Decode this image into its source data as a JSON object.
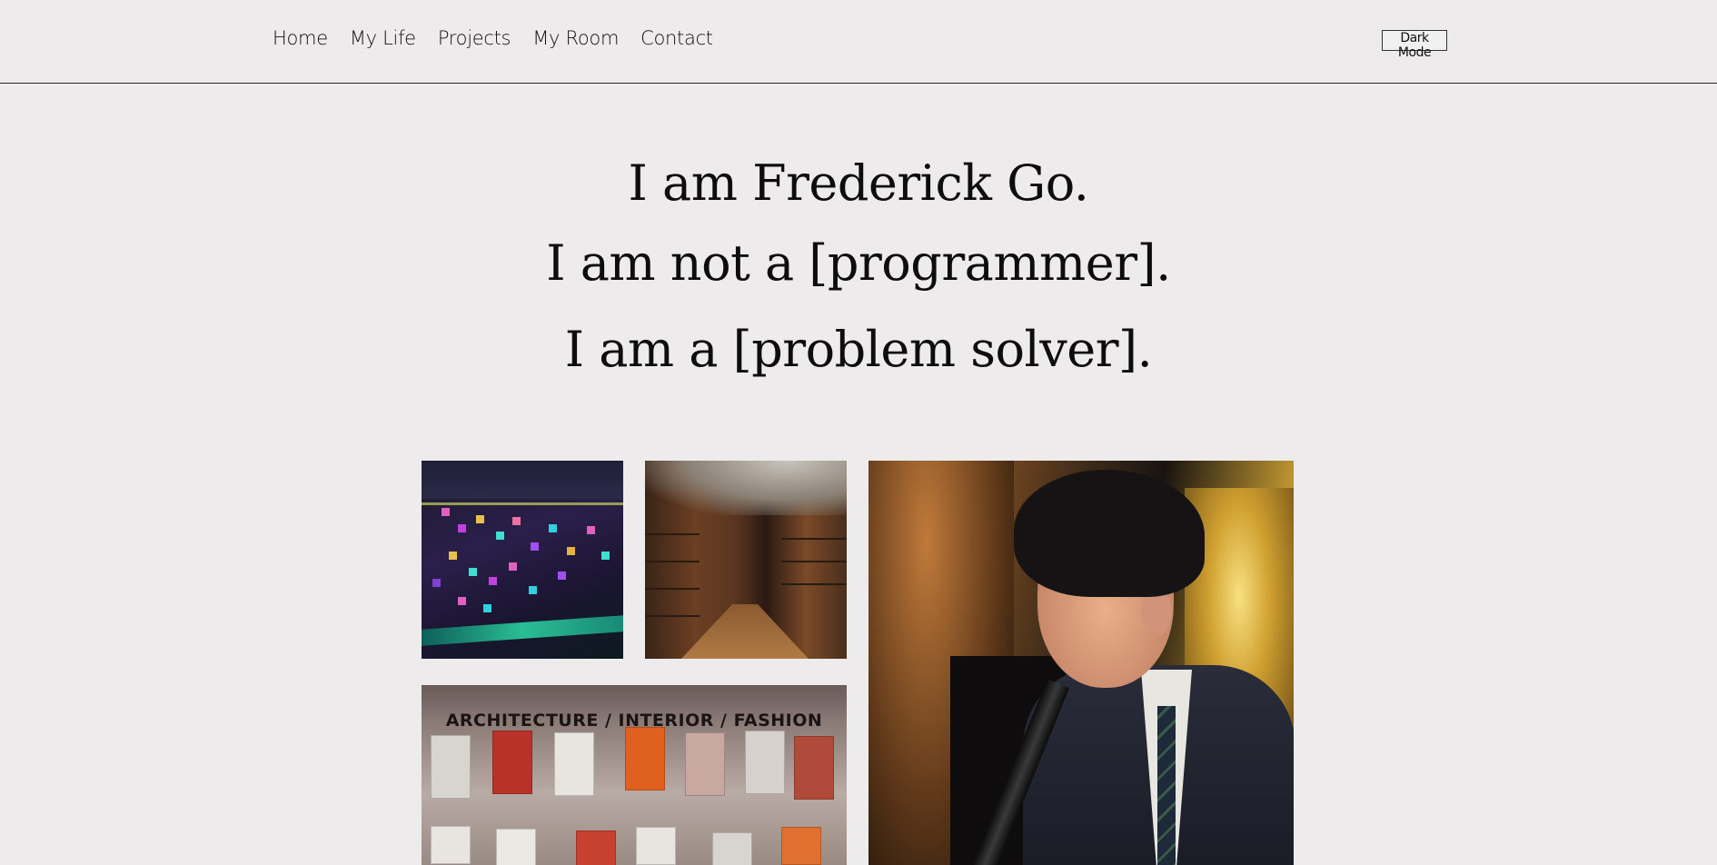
{
  "nav": {
    "items": [
      {
        "label": "Home"
      },
      {
        "label": "My Life"
      },
      {
        "label": "Projects"
      },
      {
        "label": "My Room"
      },
      {
        "label": "Contact"
      }
    ],
    "dark_mode_label": "Dark Mode"
  },
  "hero": {
    "line1": "I am Frederick Go.",
    "line2": "I am not a [programmer].",
    "line3": "I am a [problem solver]."
  },
  "gallery": {
    "magazine_banner": "ARCHITECTURE / INTERIOR / FASHION"
  },
  "colors": {
    "background": "#edebec",
    "text": "#111111"
  }
}
